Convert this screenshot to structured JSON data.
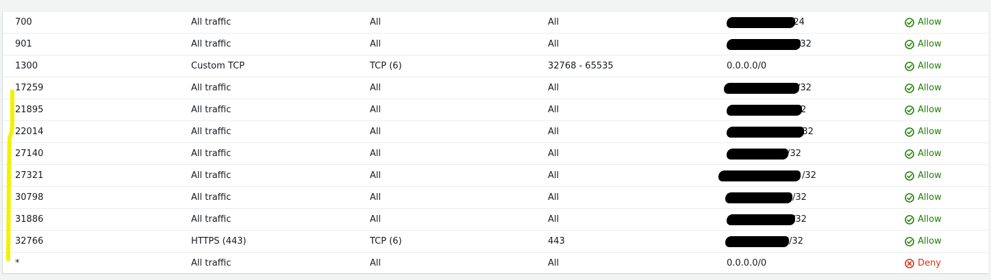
{
  "rules": [
    {
      "rule": "700",
      "type": "All traffic",
      "protocol": "All",
      "port_range": "All",
      "source": "/24",
      "source_redacted": true,
      "action": "Allow"
    },
    {
      "rule": "901",
      "type": "All traffic",
      "protocol": "All",
      "port_range": "All",
      "source": "/32",
      "source_redacted": true,
      "action": "Allow"
    },
    {
      "rule": "1300",
      "type": "Custom TCP",
      "protocol": "TCP (6)",
      "port_range": "32768 - 65535",
      "source": "0.0.0.0/0",
      "source_redacted": false,
      "action": "Allow"
    },
    {
      "rule": "17259",
      "type": "All traffic",
      "protocol": "All",
      "port_range": "All",
      "source": "/32",
      "source_redacted": true,
      "action": "Allow"
    },
    {
      "rule": "21895",
      "type": "All traffic",
      "protocol": "All",
      "port_range": "All",
      "source": "2",
      "source_redacted": true,
      "action": "Allow"
    },
    {
      "rule": "22014",
      "type": "All traffic",
      "protocol": "All",
      "port_range": "All",
      "source": "/32",
      "source_redacted": true,
      "action": "Allow"
    },
    {
      "rule": "27140",
      "type": "All traffic",
      "protocol": "All",
      "port_range": "All",
      "source": "/32",
      "source_redacted": true,
      "action": "Allow"
    },
    {
      "rule": "27321",
      "type": "All traffic",
      "protocol": "All",
      "port_range": "All",
      "source": "/32",
      "source_redacted": true,
      "action": "Allow"
    },
    {
      "rule": "30798",
      "type": "All traffic",
      "protocol": "All",
      "port_range": "All",
      "source": "/32",
      "source_redacted": true,
      "action": "Allow"
    },
    {
      "rule": "31886",
      "type": "All traffic",
      "protocol": "All",
      "port_range": "All",
      "source": "/32",
      "source_redacted": true,
      "action": "Allow"
    },
    {
      "rule": "32766",
      "type": "HTTPS (443)",
      "protocol": "TCP (6)",
      "port_range": "443",
      "source": "/32",
      "source_redacted": true,
      "action": "Allow"
    },
    {
      "rule": "*",
      "type": "All traffic",
      "protocol": "All",
      "port_range": "All",
      "source": "0.0.0.0/0",
      "source_redacted": false,
      "action": "Deny"
    }
  ],
  "colors": {
    "allow": "#1d8102",
    "deny": "#d13212",
    "highlight_marker": "#f2f200",
    "redaction": "#000000"
  },
  "icons": {
    "allow": "check-circle-icon",
    "deny": "x-circle-icon"
  }
}
